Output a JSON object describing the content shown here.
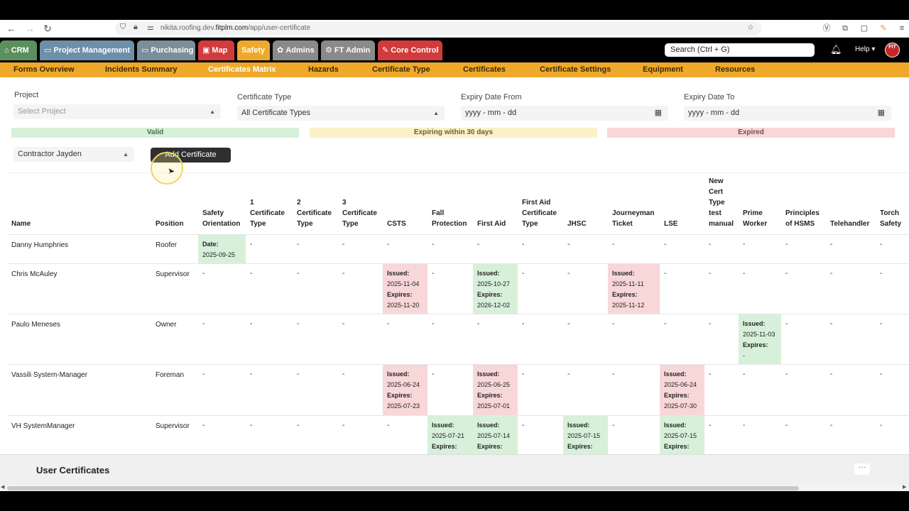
{
  "browser": {
    "url_prefix": "nikita.roofing.dev.",
    "url_domain": "fitplm.com",
    "url_path": "/app/user-certificate"
  },
  "topnav": {
    "tabs": [
      {
        "label": "CRM",
        "icon": "⌂",
        "color": "#5c8f5e"
      },
      {
        "label": "Project Management",
        "icon": "▭",
        "color": "#6e8fa8"
      },
      {
        "label": "Purchasing",
        "icon": "▭",
        "color": "#7a8f99"
      },
      {
        "label": "Map",
        "icon": "▣",
        "color": "#d13b3b"
      },
      {
        "label": "Safety",
        "icon": "",
        "color": "#eea92b"
      },
      {
        "label": "Admins",
        "icon": "✿",
        "color": "#8a8a8a"
      },
      {
        "label": "FT Admin",
        "icon": "⚙",
        "color": "#8a8a8a"
      },
      {
        "label": "Core Control",
        "icon": "✎",
        "color": "#d13b3b"
      }
    ],
    "search_placeholder": "Search (Ctrl + G)",
    "help_label": "Help ▾",
    "avatar_text": "FIT"
  },
  "subnav": {
    "items": [
      "Forms Overview",
      "Incidents Summary",
      "Certificates Matrix",
      "Hazards",
      "Certificate Type",
      "Certificates",
      "Certificate Settings",
      "Equipment",
      "Resources"
    ],
    "active": "Certificates Matrix"
  },
  "filters": {
    "project_label": "Project",
    "project_placeholder": "Select Project",
    "cert_type_label": "Certificate Type",
    "cert_type_value": "All Certificate Types",
    "expiry_from_label": "Expiry Date From",
    "expiry_from_placeholder": "yyyy - mm - dd",
    "expiry_to_label": "Expiry Date To",
    "expiry_to_placeholder": "yyyy - mm - dd"
  },
  "legend": {
    "valid": "Valid",
    "expiring": "Expiring within 30 days",
    "expired": "Expired",
    "valid_color": "#d7f0da",
    "expiring_color": "#fbf1c9",
    "expired_color": "#f8d7d9"
  },
  "controls": {
    "contractor_value": "Contractor Jayden",
    "add_button": "Add Certificate"
  },
  "matrix": {
    "columns": [
      "Name",
      "Position",
      "Safety Orientation",
      "1 Certificate Type",
      "2 Certificate Type",
      "3 Certificate Type",
      "CSTS",
      "Fall Protection",
      "First Aid",
      "First Aid Certificate Type",
      "JHSC",
      "Journeyman Ticket",
      "LSE",
      "New Cert Type test manual",
      "Prime Worker",
      "Principles of HSMS",
      "Telehandler",
      "Torch Safety"
    ],
    "rows": [
      {
        "name": "Danny Humphries",
        "position": "Roofer",
        "cells": [
          {
            "status": "valid",
            "lines": [
              [
                "Date:",
                "2025-09-25"
              ]
            ]
          },
          {
            "text": "-"
          },
          {
            "text": "-"
          },
          {
            "text": "-"
          },
          {
            "text": "-"
          },
          {
            "text": "-"
          },
          {
            "text": "-"
          },
          {
            "text": "-"
          },
          {
            "text": "-"
          },
          {
            "text": "-"
          },
          {
            "text": "-"
          },
          {
            "text": "-"
          },
          {
            "text": "-"
          },
          {
            "text": "-"
          },
          {
            "text": "-"
          },
          {
            "text": "-"
          }
        ]
      },
      {
        "name": "Chris McAuley",
        "position": "Supervisor",
        "cells": [
          {
            "text": "-"
          },
          {
            "text": "-"
          },
          {
            "text": "-"
          },
          {
            "text": "-"
          },
          {
            "status": "expired",
            "lines": [
              [
                "Issued:",
                "2025-11-04"
              ],
              [
                "Expires:",
                "2025-11-20"
              ]
            ]
          },
          {
            "text": "-"
          },
          {
            "status": "valid",
            "lines": [
              [
                "Issued:",
                "2025-10-27"
              ],
              [
                "Expires:",
                "2026-12-02"
              ]
            ]
          },
          {
            "text": "-"
          },
          {
            "text": "-"
          },
          {
            "status": "expired",
            "lines": [
              [
                "Issued:",
                "2025-11-11"
              ],
              [
                "Expires:",
                "2025-11-12"
              ]
            ]
          },
          {
            "text": "-"
          },
          {
            "text": "-"
          },
          {
            "text": "-"
          },
          {
            "text": "-"
          },
          {
            "text": "-"
          },
          {
            "text": "-"
          }
        ]
      },
      {
        "name": "Paulo Meneses",
        "position": "Owner",
        "cells": [
          {
            "text": "-"
          },
          {
            "text": "-"
          },
          {
            "text": "-"
          },
          {
            "text": "-"
          },
          {
            "text": "-"
          },
          {
            "text": "-"
          },
          {
            "text": "-"
          },
          {
            "text": "-"
          },
          {
            "text": "-"
          },
          {
            "text": "-"
          },
          {
            "text": "-"
          },
          {
            "text": "-"
          },
          {
            "status": "valid",
            "lines": [
              [
                "Issued:",
                "2025-11-03"
              ],
              [
                "Expires:",
                "-"
              ]
            ]
          },
          {
            "text": "-"
          },
          {
            "text": "-"
          },
          {
            "text": "-"
          }
        ]
      },
      {
        "name": "Vassili System-Manager",
        "position": "Foreman",
        "cells": [
          {
            "text": "-"
          },
          {
            "text": "-"
          },
          {
            "text": "-"
          },
          {
            "text": "-"
          },
          {
            "status": "expired",
            "lines": [
              [
                "Issued:",
                "2025-06-24"
              ],
              [
                "Expires:",
                "2025-07-23"
              ]
            ]
          },
          {
            "text": "-"
          },
          {
            "status": "expired",
            "lines": [
              [
                "Issued:",
                "2025-06-25"
              ],
              [
                "Expires:",
                "2025-07-01"
              ]
            ]
          },
          {
            "text": "-"
          },
          {
            "text": "-"
          },
          {
            "text": "-"
          },
          {
            "status": "expired",
            "lines": [
              [
                "Issued:",
                "2025-06-24"
              ],
              [
                "Expires:",
                "2025-07-30"
              ]
            ]
          },
          {
            "text": "-"
          },
          {
            "text": "-"
          },
          {
            "text": "-"
          },
          {
            "text": "-"
          },
          {
            "text": "-"
          }
        ]
      },
      {
        "name": "VH SystemManager",
        "position": "Supervisor",
        "cells": [
          {
            "text": "-"
          },
          {
            "text": "-"
          },
          {
            "text": "-"
          },
          {
            "text": "-"
          },
          {
            "text": "-"
          },
          {
            "status": "valid",
            "lines": [
              [
                "Issued:",
                "2025-07-21"
              ],
              [
                "Expires:",
                ""
              ]
            ]
          },
          {
            "status": "valid",
            "lines": [
              [
                "Issued:",
                "2025-07-14"
              ],
              [
                "Expires:",
                ""
              ]
            ]
          },
          {
            "text": "-"
          },
          {
            "status": "valid",
            "lines": [
              [
                "Issued:",
                "2025-07-15"
              ],
              [
                "Expires:",
                ""
              ]
            ]
          },
          {
            "text": "-"
          },
          {
            "status": "valid",
            "lines": [
              [
                "Issued:",
                "2025-07-15"
              ],
              [
                "Expires:",
                ""
              ]
            ]
          },
          {
            "text": "-"
          },
          {
            "text": "-"
          },
          {
            "text": "-"
          },
          {
            "text": "-"
          },
          {
            "text": "-"
          }
        ]
      }
    ]
  },
  "bottom": {
    "title": "User Certificates",
    "more_label": "···"
  }
}
